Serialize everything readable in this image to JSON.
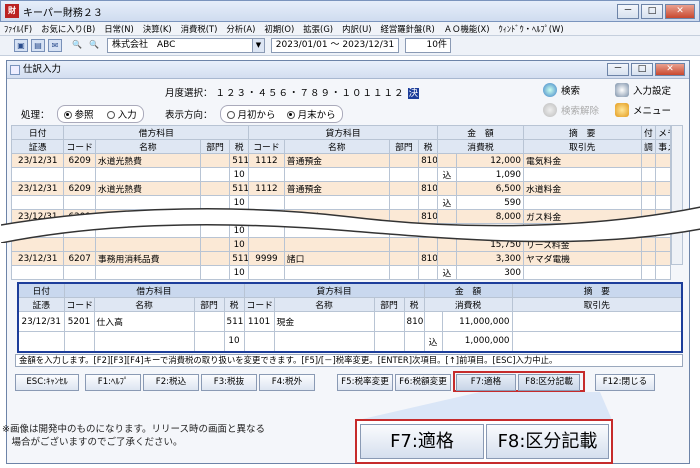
{
  "app": {
    "title": "キーパー財務２３",
    "icon": "財"
  },
  "menu": [
    "ﾌｧｲﾙ(F)",
    "お気に入り(B)",
    "日常(N)",
    "決算(K)",
    "消費税(T)",
    "分析(A)",
    "初期(O)",
    "拡張(G)",
    "内訳(U)",
    "経営羅針盤(R)",
    "ＡＯ機能(X)",
    "ｳｨﾝﾄﾞｳ・ﾍﾙﾌﾟ(W)"
  ],
  "toolbar": {
    "company": "株式会社　ABC",
    "period": "2023/01/01 ～ 2023/12/31",
    "count": "10件"
  },
  "child": {
    "title": "仕訳入力"
  },
  "controls": {
    "month_label": "月度選択：",
    "months": "１２３・４５６・７８９・１０１１１２",
    "month_sel": "決",
    "mode_label": "処理：",
    "mode_opts": [
      "参照",
      "入力"
    ],
    "dir_label": "表示方向：",
    "dir_opts": [
      "月初から",
      "月末から"
    ],
    "search": "検索",
    "search_clear": "検索解除",
    "input_settings": "入力設定",
    "menu": "メニュー"
  },
  "grid_head": {
    "date": "日付",
    "voucher": "証憑",
    "debit": "借方科目",
    "credit": "貸方科目",
    "code": "コード",
    "name": "名称",
    "dept": "部門",
    "tax": "税",
    "amount": "金　額",
    "ctax": "消費税",
    "summary": "摘　要",
    "partner": "取引先",
    "attach": "付",
    "memo": "メモ",
    "adj": "調",
    "matter": "事メモ"
  },
  "rows": [
    {
      "date": "23/12/31",
      "dcode": "6209",
      "dname": "水道光熱費",
      "dtax": "511",
      "ctaxrow": "10",
      "ccode": "1112",
      "cname": "普通預金",
      "ctx": "810",
      "amount": "12,000",
      "taxamt": "1,090",
      "summary": "電気料金"
    },
    {
      "date": "23/12/31",
      "dcode": "6209",
      "dname": "水道光熱費",
      "dtax": "511",
      "ctaxrow": "10",
      "ccode": "1112",
      "cname": "普通預金",
      "ctx": "810",
      "amount": "6,500",
      "taxamt": "590",
      "summary": "水道料金"
    },
    {
      "date": "23/12/31",
      "dcode": "6209",
      "dname": "水道光熱費",
      "dtax": "511",
      "ctaxrow": "10",
      "ccode": "1112",
      "cname": "普通預金",
      "ctx": "810",
      "amount": "8,000",
      "taxamt": "727",
      "summary": "ガス料金"
    },
    {
      "date": "",
      "dcode": "",
      "dname": "",
      "dtax": "",
      "ctaxrow": "10",
      "ccode": "",
      "cname": "",
      "ctx": "",
      "amount": "15,750",
      "taxamt": "",
      "summary": "リース料金"
    },
    {
      "date": "23/12/31",
      "dcode": "6207",
      "dname": "事務用消耗品費",
      "dtax": "511",
      "ctaxrow": "10",
      "ccode": "9999",
      "cname": "諸口",
      "ctx": "810",
      "amount": "3,300",
      "taxamt": "300",
      "summary": "ヤマダ電機"
    }
  ],
  "komi": "込",
  "entry": {
    "date": "23/12/31",
    "dcode": "5201",
    "dname": "仕入高",
    "dtax": "511",
    "ctaxrow": "10",
    "ccode": "1101",
    "cname": "現金",
    "ctx": "810",
    "amount": "11,000,000",
    "taxamt": "1,000,000"
  },
  "status": "金額を入力します。[F2][F3][F4]キーで消費税の取り扱いを変更できます。[F5]/[－]税率変更。[ENTER]次項目。[↑]前項目。[ESC]入力中止。",
  "fkeys": [
    "ESC:ｷｬﾝｾﾙ",
    "F1:ﾍﾙﾌﾟ",
    "F2:税込",
    "F3:税抜",
    "F4:税外",
    "F5:税率変更",
    "F6:税額変更",
    "F7:適格",
    "F8:区分記載",
    "F12:閉じる"
  ],
  "zoom": {
    "f7": "F7:適格",
    "f8": "F8:区分記載"
  },
  "note": [
    "※画像は開発中のものになります。リリース時の画面と異なる",
    "　場合がございますのでご了承ください。"
  ]
}
